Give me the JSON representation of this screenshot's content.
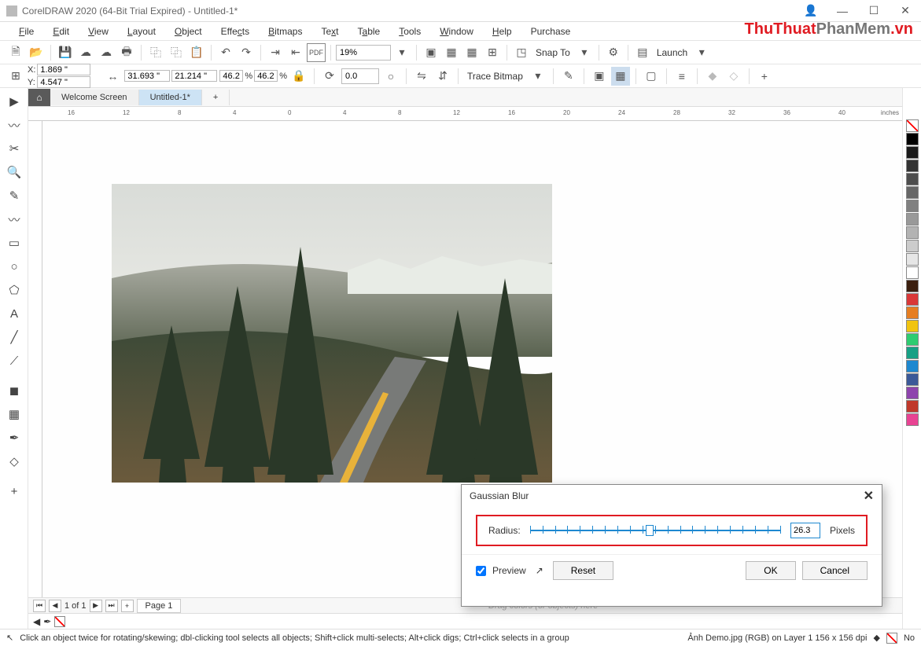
{
  "titlebar": {
    "text": "CorelDRAW 2020 (64-Bit Trial Expired) - Untitled-1*"
  },
  "watermark": {
    "red": "ThuThuat",
    "grey": "PhanMem",
    "suffix": ".vn"
  },
  "menu": [
    "File",
    "Edit",
    "View",
    "Layout",
    "Object",
    "Effects",
    "Bitmaps",
    "Text",
    "Table",
    "Tools",
    "Window",
    "Help",
    "Purchase"
  ],
  "toolbar": {
    "zoom": "19%",
    "snap": "Snap To",
    "launch": "Launch"
  },
  "propbar": {
    "x_label": "X:",
    "x": "1.869 \"",
    "y_label": "Y:",
    "y": "4.547 \"",
    "w": "31.693 \"",
    "h": "21.214 \"",
    "sx": "46.2",
    "sy": "46.2",
    "pct": "%",
    "rot": "0.0",
    "trace": "Trace Bitmap"
  },
  "tabs": {
    "welcome": "Welcome Screen",
    "doc": "Untitled-1*"
  },
  "ruler_h": [
    "16",
    "12",
    "8",
    "4",
    "0",
    "4",
    "8",
    "12",
    "16",
    "20",
    "24",
    "28",
    "32",
    "36",
    "40"
  ],
  "ruler_unit": "inches",
  "pagebar": {
    "pos": "1 of 1",
    "page": "Page 1",
    "hint": "Drag colors (or objects) here"
  },
  "statusbar": {
    "hint": "Click an object twice for rotating/skewing; dbl-clicking tool selects all objects; Shift+click multi-selects; Alt+click digs; Ctrl+click selects in a group",
    "info": "Ảnh Demo.jpg (RGB) on Layer 1 156 x 156 dpi",
    "fill": "No"
  },
  "palette": [
    "#ffffff",
    "#000000",
    "#1a1a1a",
    "#333333",
    "#4d4d4d",
    "#666666",
    "#808080",
    "#999999",
    "#b3b3b3",
    "#cccccc",
    "#e6e6e6",
    "#ffffff",
    "#3b1f0f",
    "#d93838",
    "#e67e22",
    "#f1c40f",
    "#2ecc71",
    "#16a085",
    "#1e88d0",
    "#3b5998",
    "#8e44ad",
    "#c0392b",
    "#e84393"
  ],
  "dialog": {
    "title": "Gaussian Blur",
    "radius_label": "Radius:",
    "radius_value": "26.3",
    "pixels": "Pixels",
    "preview": "Preview",
    "reset": "Reset",
    "ok": "OK",
    "cancel": "Cancel"
  }
}
